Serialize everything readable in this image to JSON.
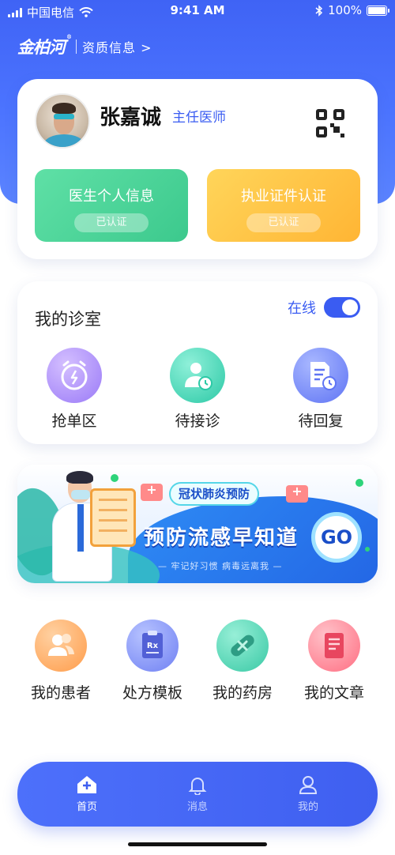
{
  "status_bar": {
    "carrier": "中国电信",
    "time": "9:41 AM",
    "battery": "100%",
    "battery_level": 1.0
  },
  "brand": {
    "logo": "金柏河",
    "trademark": "®",
    "qualification_link": "资质信息 >"
  },
  "profile": {
    "name": "张嘉诚",
    "title": "主任医师",
    "cards": [
      {
        "label": "医生个人信息",
        "status": "已认证"
      },
      {
        "label": "执业证件认证",
        "status": "已认证"
      }
    ]
  },
  "clinic": {
    "heading": "我的诊室",
    "online_label": "在线",
    "online": true,
    "items": [
      {
        "label": "抢单区",
        "icon": "alarm-clock-icon"
      },
      {
        "label": "待接诊",
        "icon": "doctor-clock-icon"
      },
      {
        "label": "待回复",
        "icon": "document-clock-icon"
      }
    ]
  },
  "banner": {
    "tag": "冠状肺炎预防",
    "title": "预防流感早知道",
    "subtitle": "— 牢记好习惯 病毒远离我 —",
    "go": "GO"
  },
  "tools": [
    {
      "label": "我的患者",
      "icon": "patients-icon"
    },
    {
      "label": "处方模板",
      "icon": "prescription-icon"
    },
    {
      "label": "我的药房",
      "icon": "pill-icon"
    },
    {
      "label": "我的文章",
      "icon": "article-icon"
    }
  ],
  "tabbar": [
    {
      "label": "首页",
      "icon": "home-icon",
      "active": true
    },
    {
      "label": "消息",
      "icon": "bell-icon",
      "active": false
    },
    {
      "label": "我的",
      "icon": "user-icon",
      "active": false
    }
  ],
  "colors": {
    "primary": "#3f63f5",
    "accent_text": "#3a5cf2",
    "green": "#3cc98d",
    "yellow": "#ffb534"
  }
}
